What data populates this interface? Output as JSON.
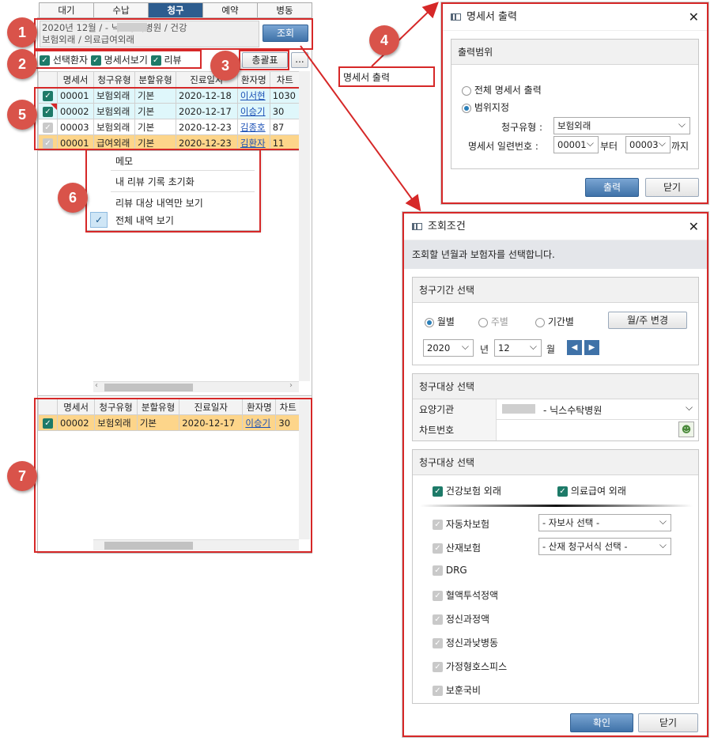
{
  "tabs": [
    "대기",
    "수납",
    "청구",
    "예약",
    "병동"
  ],
  "active_tab": 2,
  "summary": {
    "line1": "2020년  12월  /            - 닉스수탁병원  / 건강",
    "line2": "보험외래  / 의료급여외래",
    "query_button": "조회"
  },
  "options": {
    "selected_patients": "선택환자",
    "statement_view": "명세서보기",
    "review": "리뷰",
    "summary_button": "총괄표",
    "more_button": "..."
  },
  "grid": {
    "columns": [
      "명세서",
      "청구유형",
      "분할유형",
      "진료일자",
      "환자명",
      "차트"
    ],
    "rows": [
      {
        "checked": true,
        "num": "00001",
        "type": "보험외래",
        "split": "기본",
        "date": "2020-12-18",
        "name": "이서현",
        "chart": "1030"
      },
      {
        "checked": true,
        "num": "00002",
        "type": "보험외래",
        "split": "기본",
        "date": "2020-12-17",
        "name": "이승기",
        "chart": "30"
      },
      {
        "checked": false,
        "num": "00003",
        "type": "보험외래",
        "split": "기본",
        "date": "2020-12-23",
        "name": "김종호",
        "chart": "87"
      },
      {
        "checked": false,
        "num": "00001",
        "type": "급여외래",
        "split": "기본",
        "date": "2020-12-23",
        "name": "김환자",
        "chart": "11"
      }
    ]
  },
  "context_menu": {
    "items": [
      "메모",
      "내 리뷰 기록 초기화",
      "리뷰 대상 내역만 보기",
      "전체 내역 보기"
    ],
    "checked_index": 3
  },
  "bottom_grid": {
    "columns": [
      "명세서",
      "청구유형",
      "분할유형",
      "진료일자",
      "환자명",
      "차트"
    ],
    "rows": [
      {
        "checked": true,
        "num": "00002",
        "type": "보험외래",
        "split": "기본",
        "date": "2020-12-17",
        "name": "이승기",
        "chart": "30"
      }
    ]
  },
  "popup_menu": {
    "item": "명세서 출력"
  },
  "markers": [
    "1",
    "2",
    "3",
    "4",
    "5",
    "6",
    "7"
  ],
  "print_dialog": {
    "title": "명세서 출력",
    "section": "출력범위",
    "radio_all": "전체 명세서 출력",
    "radio_range": "범위지정",
    "claim_type_label": "청구유형  :",
    "claim_type_value": "보험외래",
    "serial_label": "명세서 일련번호  :",
    "from_value": "00001",
    "from_label": "부터",
    "to_value": "00003",
    "to_label": "까지",
    "print_button": "출력",
    "close_button": "닫기"
  },
  "query_dialog": {
    "title": "조회조건",
    "description": "조회할 년월과 보험자를 선택합니다.",
    "period_section": "청구기간 선택",
    "radio_monthly": "월별",
    "radio_weekly": "주별",
    "radio_period": "기간별",
    "change_button": "월/주 변경",
    "year_value": "2020",
    "year_label": "년",
    "month_value": "12",
    "month_label": "월",
    "target_section": "청구대상 선택",
    "institution_label": "요양기관",
    "institution_value": "- 닉스수탁병원",
    "chart_label": "차트번호",
    "target_section2": "청구대상 선택",
    "health_insurance": "건강보험 외래",
    "medical_aid": "의료급여 외래",
    "auto_insurance": "자동차보험",
    "auto_select": "- 자보사 선택 -",
    "industrial": "산재보험",
    "industrial_select": "- 산재 청구서식 선택 -",
    "others": [
      "DRG",
      "혈액투석정액",
      "정신과정액",
      "정신과낮병동",
      "가정형호스피스",
      "보훈국비"
    ],
    "confirm_button": "확인",
    "close_button": "닫기"
  },
  "colors": {
    "accent_red": "#d62828",
    "marker": "#d9534a",
    "tab_active": "#2e5d8f",
    "check": "#1d7a68"
  }
}
